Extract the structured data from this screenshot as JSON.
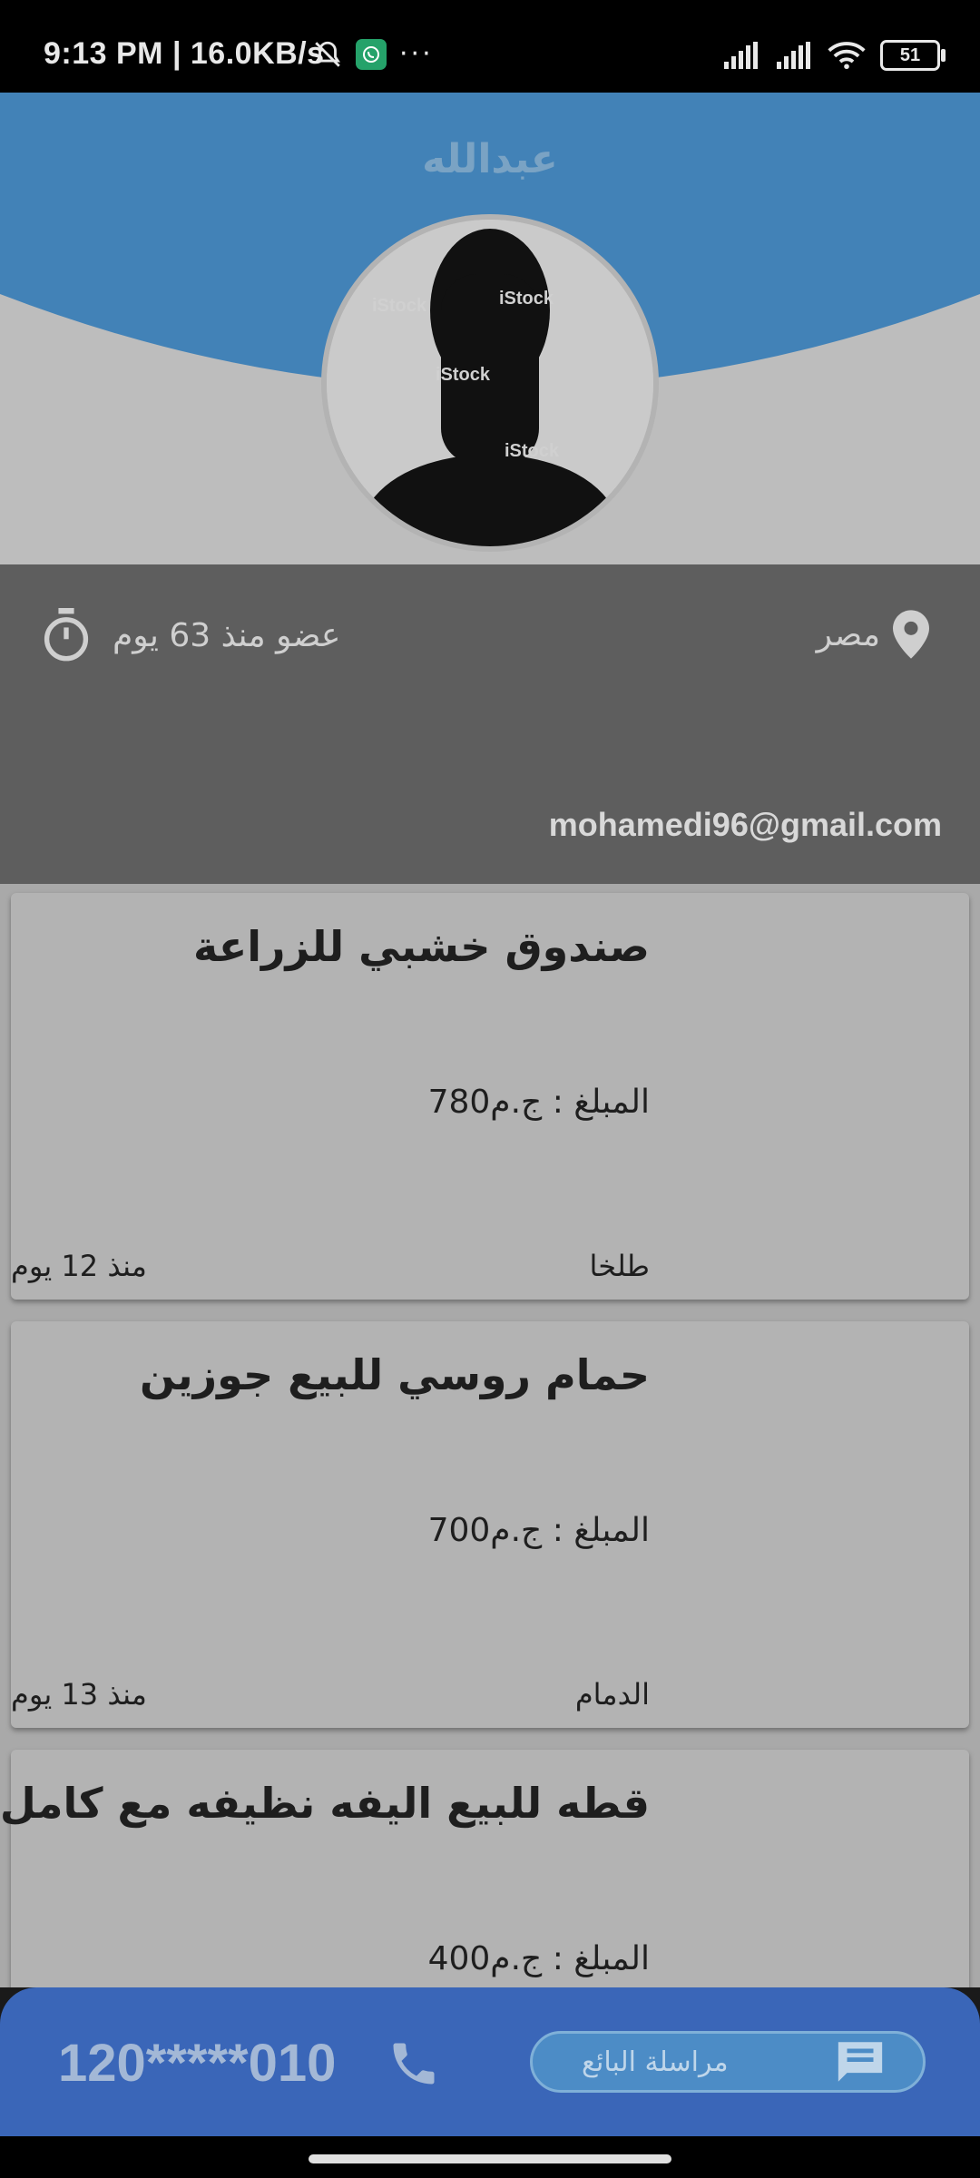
{
  "status_bar": {
    "time": "9:13 PM | 16.0KB/s",
    "battery": "51"
  },
  "header": {
    "title": "عبدالله",
    "avatar_watermark": "iStock"
  },
  "info": {
    "location": "مصر",
    "member_since": "عضو منذ 63 يوم",
    "email": "mohamedi96@gmail.com"
  },
  "listings": [
    {
      "title": "صندوق خشبي للزراعة",
      "price": "المبلغ : ج.م780",
      "city": "طلخا",
      "ago": "منذ 12 يوم"
    },
    {
      "title": "حمام روسي للبيع جوزين",
      "price": "المبلغ : ج.م700",
      "city": "الدمام",
      "ago": "منذ 13 يوم"
    },
    {
      "title": "قطه للبيع اليفه نظيفه مع كامل...",
      "price": "المبلغ : ج.م400",
      "city": "",
      "ago": ""
    }
  ],
  "bottom_bar": {
    "phone": "120*****010",
    "message_button": "مراسلة البائع"
  },
  "colors": {
    "header_blue": "#1a6fb5",
    "bottom_bar": "#3a66b8"
  }
}
